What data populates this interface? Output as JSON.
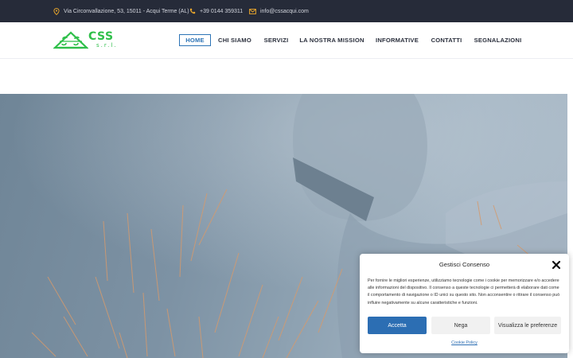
{
  "topbar": {
    "address": "Via Circonvallazione, 53, 15011 - Acqui Terme (AL)",
    "phone": "+39 0144 359311",
    "email": "info@cssacqui.com"
  },
  "logo": {
    "main": "CSS",
    "sub": "s.r.l."
  },
  "nav": {
    "items": [
      {
        "label": "HOME"
      },
      {
        "label": "CHI SIAMO"
      },
      {
        "label": "SERVIZI"
      },
      {
        "label": "LA NOSTRA MISSION"
      },
      {
        "label": "INFORMATIVE"
      },
      {
        "label": "CONTATTI"
      },
      {
        "label": "SEGNALAZIONI"
      }
    ]
  },
  "cookie": {
    "title": "Gestisci Consenso",
    "text": "Per fornire le migliori esperienze, utilizziamo tecnologie come i cookie per memorizzare e/o accedere alle informazioni del dispositivo. Il consenso a queste tecnologie ci permetterà di elaborare dati come il comportamento di navigazione o ID unici su questo sito. Non acconsentire o ritirare il consenso può influire negativamente su alcune caratteristiche e funzioni.",
    "accept": "Accetta",
    "deny": "Nega",
    "preferences": "Visualizza le preferenze",
    "policy": "Cookie Policy"
  },
  "colors": {
    "topbar": "#262b39",
    "accent": "#2d74b6",
    "brand": "#2fbf4a",
    "icon": "#e7a52c"
  },
  "icons": {
    "address": "location-pin-icon",
    "phone": "phone-icon",
    "email": "envelope-icon",
    "close": "close-icon"
  }
}
